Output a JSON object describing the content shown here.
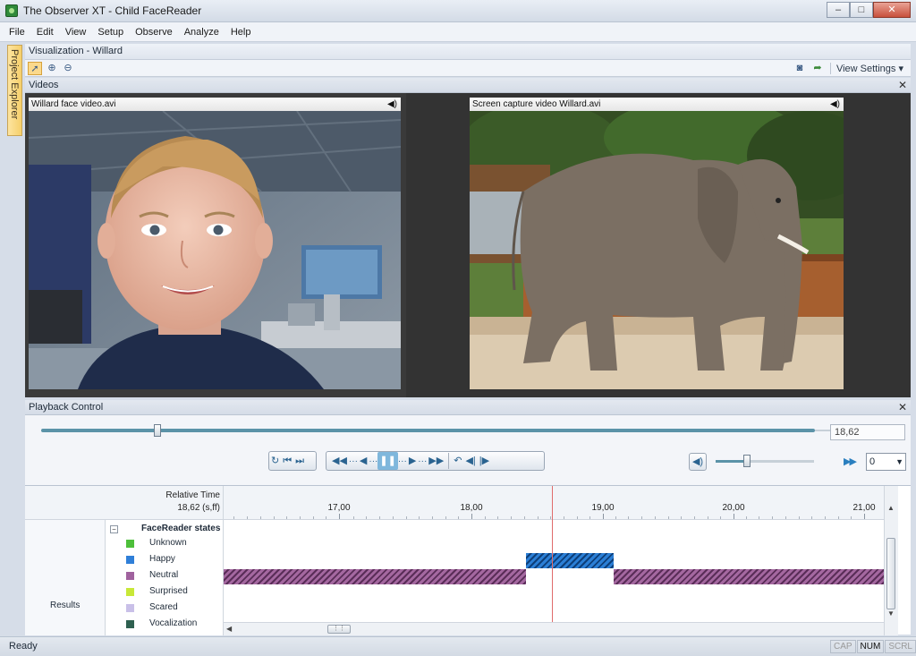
{
  "window": {
    "title": "The Observer XT  - Child FaceReader",
    "minimize": "–",
    "maximize": "□",
    "close": "✕"
  },
  "menu": [
    "File",
    "Edit",
    "View",
    "Setup",
    "Observe",
    "Analyze",
    "Help"
  ],
  "project_explorer": "Project Explorer",
  "visualization": {
    "title": "Visualization - Willard",
    "view_settings": "View Settings"
  },
  "videos": {
    "header": "Videos",
    "left": {
      "title": "Willard face video.avi"
    },
    "right": {
      "title": "Screen capture video Willard.avi"
    }
  },
  "playback": {
    "header": "Playback Control",
    "position_fraction": 0.15,
    "time": "18,62",
    "volume_fraction": 0.3,
    "speed": "0"
  },
  "timeline": {
    "relative_time_label": "Relative Time",
    "current_time": "18,62 (s,ff)",
    "ticks": [
      "17,00",
      "18,00",
      "19,00",
      "20,00",
      "21,00"
    ],
    "results_label": "Results",
    "legend_title": "FaceReader states",
    "states": [
      {
        "label": "Unknown",
        "color": "#4dbf3a"
      },
      {
        "label": "Happy",
        "color": "#2f7fd8"
      },
      {
        "label": "Neutral",
        "color": "#a0629e"
      },
      {
        "label": "Surprised",
        "color": "#c8e838"
      },
      {
        "label": "Scared",
        "color": "#c9c0e8"
      },
      {
        "label": "Vocalization",
        "color": "#2e6050"
      }
    ]
  },
  "status": {
    "text": "Ready",
    "keys": [
      "CAP",
      "NUM",
      "SCRL"
    ]
  }
}
